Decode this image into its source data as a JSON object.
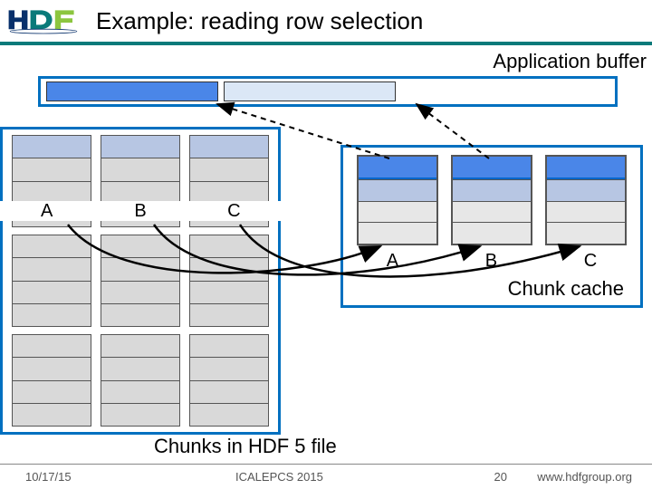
{
  "header": {
    "title": "Example: reading row selection"
  },
  "app_buffer": {
    "label": "Application buffer"
  },
  "file": {
    "columns": [
      "A",
      "B",
      "C"
    ],
    "caption": "Chunks in HDF 5 file"
  },
  "cache": {
    "columns": [
      "A",
      "B",
      "C"
    ],
    "title": "Chunk cache"
  },
  "footer": {
    "date": "10/17/15",
    "venue": "ICALEPCS 2015",
    "page": "20",
    "url": "www.hdfgroup.org"
  }
}
